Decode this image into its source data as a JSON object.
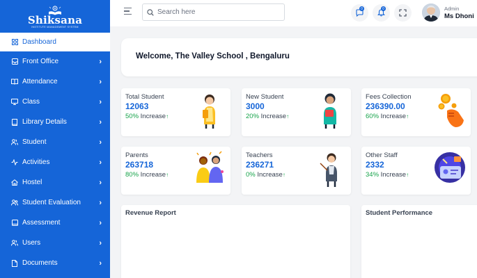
{
  "brand": {
    "name": "Shiksana",
    "tagline": "INSTITUTE MANAGEMENT SYSTEM",
    "accent": "#1565d8"
  },
  "sidebar": {
    "items": [
      {
        "label": "Dashboard",
        "icon": "grid-icon",
        "active": true
      },
      {
        "label": "Front Office",
        "icon": "inbox-icon"
      },
      {
        "label": "Attendance",
        "icon": "book-open-icon"
      },
      {
        "label": "Class",
        "icon": "monitor-icon"
      },
      {
        "label": "Library Details",
        "icon": "book-icon"
      },
      {
        "label": "Student",
        "icon": "users-icon"
      },
      {
        "label": "Activities",
        "icon": "activity-icon"
      },
      {
        "label": "Hostel",
        "icon": "home-icon"
      },
      {
        "label": "Student Evaluation",
        "icon": "users-icon"
      },
      {
        "label": "Assessment",
        "icon": "tablet-icon"
      },
      {
        "label": "Users",
        "icon": "users-icon"
      },
      {
        "label": "Documents",
        "icon": "document-icon"
      }
    ]
  },
  "header": {
    "search_placeholder": "Search here",
    "message_badge": "0",
    "notification_badge": "0",
    "user_role": "Admin",
    "user_name": "Ms Dhoni"
  },
  "welcome": {
    "text": "Welcome, The Valley School , Bengaluru"
  },
  "stats": [
    {
      "title": "Total Student",
      "value": "12063",
      "pct": "50%",
      "suffix": " Increase",
      "arrow": "↑",
      "illustration": "student-illustration"
    },
    {
      "title": "New Student",
      "value": "3000",
      "pct": "20%",
      "suffix": " Increase",
      "arrow": "↑",
      "illustration": "reading-student-illustration"
    },
    {
      "title": "Fees Collection",
      "value": "236390.00",
      "pct": "60%",
      "suffix": " Increase",
      "arrow": "↑",
      "illustration": "coins-hand-illustration"
    },
    {
      "title": "Parents",
      "value": "263718",
      "pct": "80%",
      "suffix": " Increase",
      "arrow": "↑",
      "illustration": "parents-illustration"
    },
    {
      "title": "Teachers",
      "value": "236271",
      "pct": "0%",
      "suffix": " Increase",
      "arrow": "↑",
      "illustration": "teacher-illustration"
    },
    {
      "title": "Other Staff",
      "value": "2332",
      "pct": "34%",
      "suffix": " Increase",
      "arrow": "↑",
      "illustration": "staff-id-illustration"
    }
  ],
  "panels": {
    "revenue_title": "Revenue Report",
    "performance_title": "Student Performance"
  }
}
